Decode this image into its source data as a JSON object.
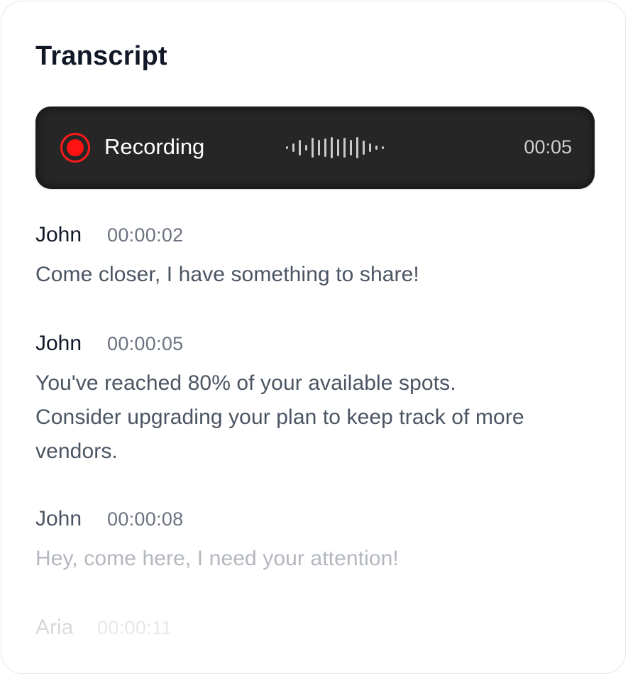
{
  "title": "Transcript",
  "recording": {
    "label": "Recording",
    "elapsed": "00:05",
    "icon": "record-icon",
    "accent_color": "#ff1212"
  },
  "entries": [
    {
      "speaker": "John",
      "time": "00:00:02",
      "message": "Come closer, I have something to share!"
    },
    {
      "speaker": "John",
      "time": "00:00:05",
      "message": "You've reached 80% of your available spots. Consider upgrading your plan to keep track of more vendors."
    },
    {
      "speaker": "John",
      "time": "00:00:08",
      "message": "Hey, come here, I need your attention!"
    },
    {
      "speaker": "Aria",
      "time": "00:00:11",
      "message": ""
    }
  ]
}
